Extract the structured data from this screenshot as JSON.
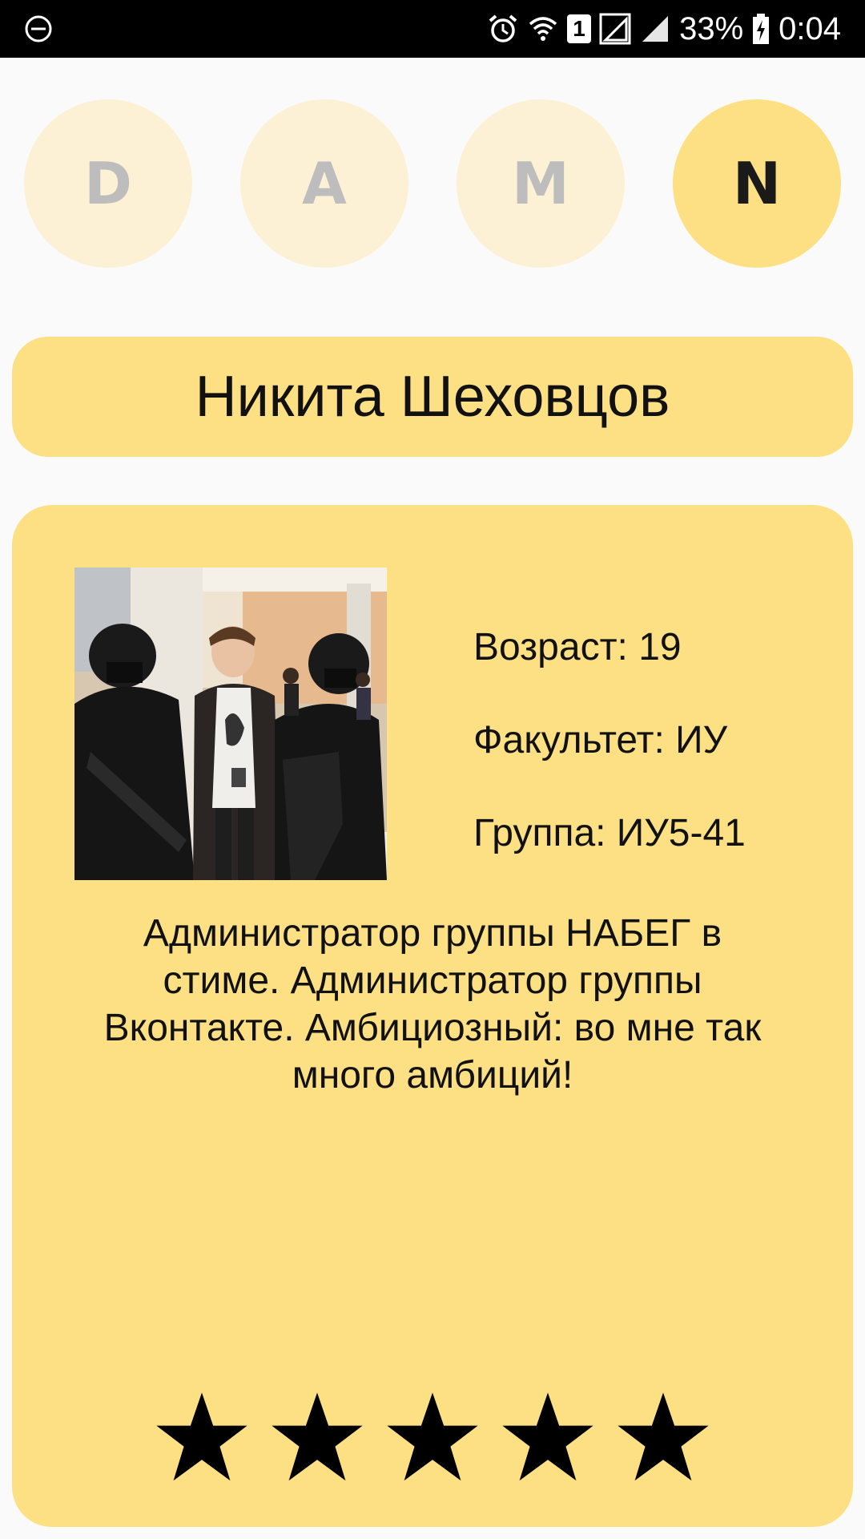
{
  "status_bar": {
    "battery_percent": "33%",
    "time": "0:04",
    "sim_slot": "1"
  },
  "tabs": [
    {
      "letter": "D",
      "selected": false
    },
    {
      "letter": "A",
      "selected": false
    },
    {
      "letter": "M",
      "selected": false
    },
    {
      "letter": "N",
      "selected": true
    }
  ],
  "profile": {
    "name": "Никита Шеховцов",
    "age": "Возраст: 19",
    "faculty": "Факультет: ИУ",
    "group": "Группа: ИУ5-41",
    "description": "Администратор группы НАБЕГ в стиме. Администратор группы Вконтакте. Амбициозный: во мне так много амбиций!",
    "rating": 5,
    "rating_max": 5
  },
  "colors": {
    "accent": "#fde084",
    "accent_light": "#fcf1d5",
    "background": "#fafafa"
  }
}
